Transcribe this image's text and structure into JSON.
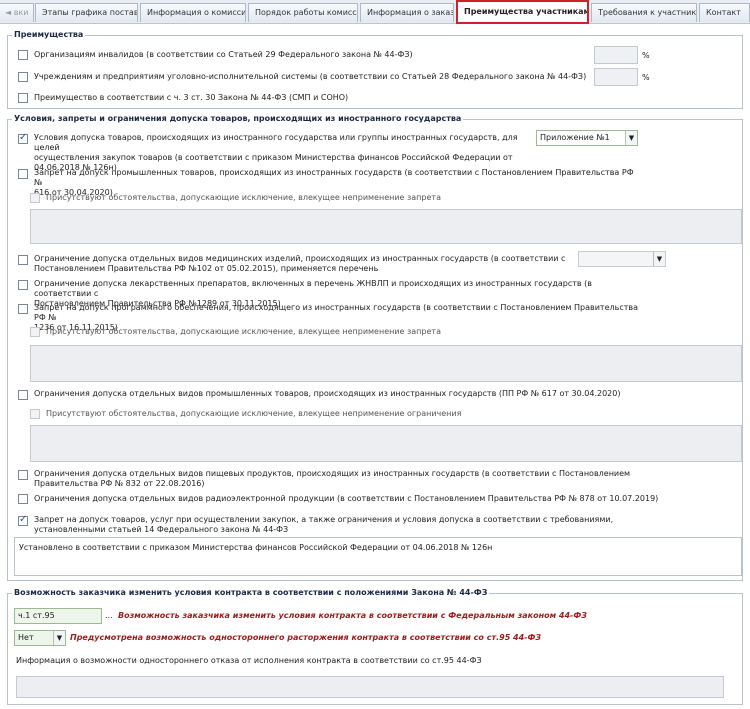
{
  "tabs": [
    {
      "label": "◄ вки"
    },
    {
      "label": "Этапы графика поставки"
    },
    {
      "label": "Информация о комиссии"
    },
    {
      "label": "Порядок работы комиссии"
    },
    {
      "label": "Информация о заказе"
    },
    {
      "label": "Преимущества участникам"
    },
    {
      "label": "Требования к участникам"
    },
    {
      "label": "Контакт"
    }
  ],
  "advantages": {
    "legend": "Преимущества",
    "items": [
      {
        "label": "Организациям инвалидов (в соответствии со Статьей 29 Федерального закона № 44-ФЗ)",
        "pct": "%"
      },
      {
        "label": "Учреждениям и предприятиям уголовно-исполнительной системы (в соответствии со Статьей 28 Федерального закона № 44-ФЗ)",
        "pct": "%"
      },
      {
        "label": "Преимущество в соответствии с ч. 3 ст. 30 Закона № 44-ФЗ (СМП и СОНО)"
      }
    ]
  },
  "conditions": {
    "legend": "Условия, запреты и ограничения допуска товаров, происходящих из иностранного государства",
    "c1": {
      "line1": "Условия допуска товаров, происходящих из иностранного государства или группы иностранных государств, для целей",
      "line2": "осуществления закупок товаров (в соответствии с приказом Министерства финансов Российской Федерации от",
      "line3": "04.06.2018 № 126н)",
      "select": "Приложение №1"
    },
    "c2": {
      "line1": "Запрет на допуск промышленных товаров, происходящих из иностранных государств (в соответствии с Постановлением Правительства РФ №",
      "line2": "616 от 30.04.2020)",
      "sub": "Присутствуют обстоятельства, допускающие исключение, влекущее неприменение запрета"
    },
    "c3": {
      "line1": "Ограничение допуска отдельных видов медицинских изделий, происходящих из иностранных государств (в соответствии с",
      "line2": "Постановлением Правительства РФ №102 от 05.02.2015), применяется перечень"
    },
    "c4": {
      "line1": "Ограничение допуска лекарственных препаратов, включенных в перечень ЖНВЛП и происходящих из иностранных государств (в соответствии с",
      "line2": "Постановлением Правительства РФ №1289 от 30.11.2015)"
    },
    "c5": {
      "line1": "Запрет на допуск программного обеспечения, происходящего из иностранных государств (в соответствии с Постановлением Правительства РФ №",
      "line2": "1236 от 16.11.2015)",
      "sub": "Присутствуют обстоятельства, допускающие исключение, влекущее неприменение запрета"
    },
    "c6": {
      "line1": "Ограничения допуска отдельных видов промышленных товаров, происходящих из иностранных государств (ПП РФ № 617 от 30.04.2020)",
      "sub": "Присутствуют обстоятельства, допускающие исключение, влекущее неприменение ограничения"
    },
    "c7": {
      "line1": "Ограничения допуска отдельных видов пищевых продуктов, происходящих из иностранных государств (в соответствии с Постановлением",
      "line2": "Правительства РФ № 832 от 22.08.2016)"
    },
    "c8": {
      "line1": "Ограничения допуска отдельных видов радиоэлектронной продукции (в соответствии с Постановлением Правительства РФ № 878 от 10.07.2019)"
    },
    "c9": {
      "line1": "Запрет на допуск товаров, услуг при осуществлении закупок, а также ограничения и условия допуска в соответствии с требованиями,",
      "line2": "установленными статьей 14 Федерального закона № 44-ФЗ",
      "text": "Установлено в соответствии с приказом Министерства финансов Российской Федерации от 04.06.2018 № 126н"
    }
  },
  "contract": {
    "legend": "Возможность заказчика изменить условия контракта в соответствии с положениями Закона № 44-ФЗ",
    "article_value": "ч.1 ст.95",
    "ellipsis": "...",
    "article_label": "Возможность заказчика изменить условия контракта в соответствии с Федеральным законом 44-ФЗ",
    "unilateral_value": "Нет",
    "unilateral_label": "Предусмотрена возможность одностороннего расторжения контракта в соответствии со ст.95 44-ФЗ",
    "info_label": "Информация о возможности одностороннего отказа от исполнения контракта в соответствии со ст.95 44-ФЗ"
  }
}
